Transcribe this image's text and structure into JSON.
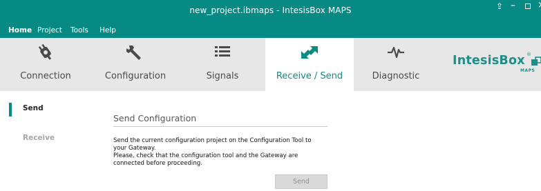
{
  "window": {
    "title": "new_project.ibmaps - IntesisBox MAPS",
    "controls": {
      "upload": "⇪",
      "minimize": "–",
      "close": "×"
    }
  },
  "menu": {
    "items": [
      "Home",
      "Project",
      "Tools",
      "Help"
    ]
  },
  "ribbon": {
    "tabs": [
      {
        "label": "Connection",
        "icon": "plug-icon"
      },
      {
        "label": "Configuration",
        "icon": "wrench-icon"
      },
      {
        "label": "Signals",
        "icon": "list-icon"
      },
      {
        "label": "Receive / Send",
        "icon": "transfer-arrows-icon",
        "active": true
      },
      {
        "label": "Diagnostic",
        "icon": "pulse-icon"
      }
    ],
    "logo": {
      "word": "IntesisBox",
      "sub": "MAPS",
      "reg": "®"
    }
  },
  "sidebar": {
    "items": [
      {
        "label": "Send",
        "active": true
      },
      {
        "label": "Receive",
        "active": false
      }
    ]
  },
  "content": {
    "title": "Send Configuration",
    "lines": [
      "Send the current configuration project on the Configuration Tool to",
      "your Gateway.",
      "Please, check that the configuration tool and the Gateway are",
      "connected before proceeding."
    ],
    "send_button": "Send"
  },
  "colors": {
    "accent": "#078a84",
    "ribbon_bg": "#e7e7e7",
    "active_tab_text": "#0d8a82",
    "inactive_nav": "#a6a6a6"
  }
}
